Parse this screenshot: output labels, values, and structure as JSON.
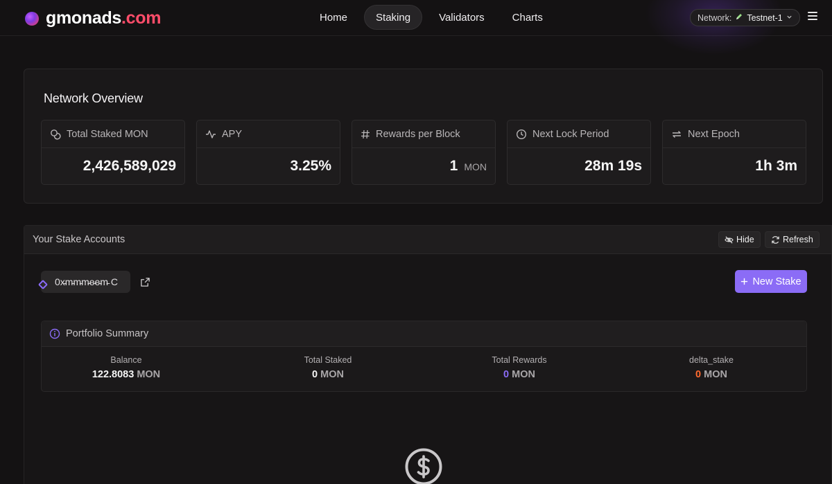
{
  "header": {
    "logo_main": "gmonads",
    "logo_tld": ".com",
    "nav": [
      {
        "label": "Home",
        "active": false
      },
      {
        "label": "Staking",
        "active": true
      },
      {
        "label": "Validators",
        "active": false
      },
      {
        "label": "Charts",
        "active": false
      }
    ],
    "network_label": "Network:",
    "network_value": "Testnet-1"
  },
  "overview": {
    "title": "Network Overview",
    "stats": [
      {
        "label": "Total Staked MON",
        "value": "2,426,589,029",
        "unit": "",
        "icon": "coins-icon"
      },
      {
        "label": "APY",
        "value": "3.25%",
        "unit": "",
        "icon": "activity-icon"
      },
      {
        "label": "Rewards per Block",
        "value": "1",
        "unit": "MON",
        "icon": "hash-icon"
      },
      {
        "label": "Next Lock Period",
        "value": "28m 19s",
        "unit": "",
        "icon": "clock-icon"
      },
      {
        "label": "Next Epoch",
        "value": "1h 3m",
        "unit": "",
        "icon": "repeat-icon"
      }
    ]
  },
  "accounts": {
    "title": "Your Stake Accounts",
    "hide_label": "Hide",
    "refresh_label": "Refresh",
    "address": "0x̵m̵m̵m̵e̵e̵m̵ C",
    "new_stake_label": "New Stake",
    "portfolio": {
      "title": "Portfolio Summary",
      "items": [
        {
          "label": "Balance",
          "value": "122.8083",
          "unit": "MON",
          "color": "#f5f5f5"
        },
        {
          "label": "Total Staked",
          "value": "0",
          "unit": "MON",
          "color": "#f5f5f5"
        },
        {
          "label": "Total Rewards",
          "value": "0",
          "unit": "MON",
          "color": "#8b6cf6"
        },
        {
          "label": "delta_stake",
          "value": "0",
          "unit": "MON",
          "color": "#ff6a2f"
        }
      ]
    }
  },
  "colors": {
    "accent": "#8b6cf6",
    "brand_red": "#ff4d6a",
    "delta_orange": "#ff6a2f"
  }
}
